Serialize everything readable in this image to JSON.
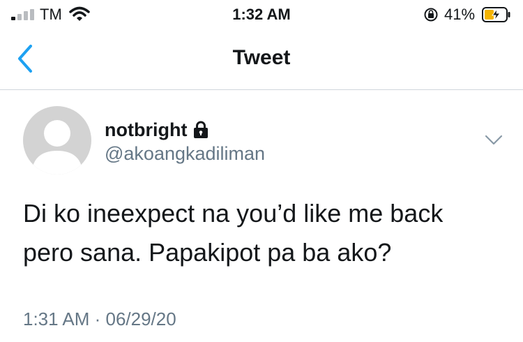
{
  "status_bar": {
    "carrier": "TM",
    "time": "1:32 AM",
    "battery_percent": "41%",
    "icons": [
      "signal-icon",
      "wifi-icon",
      "orientation-lock-icon",
      "battery-charging-icon"
    ]
  },
  "nav": {
    "title": "Tweet",
    "back_icon": "chevron-left-icon"
  },
  "tweet": {
    "display_name": "notbright",
    "protected_icon": "lock-icon",
    "handle": "@akoangkadiliman",
    "text": "Di ko ineexpect na you’d like me back\npero sana. Papakipot pa ba ako?",
    "timestamp": "1:31 AM · 06/29/20",
    "menu_icon": "chevron-down-icon"
  },
  "colors": {
    "accent": "#1da1f2",
    "secondary_text": "#657786",
    "battery_fill": "#f4b400"
  }
}
